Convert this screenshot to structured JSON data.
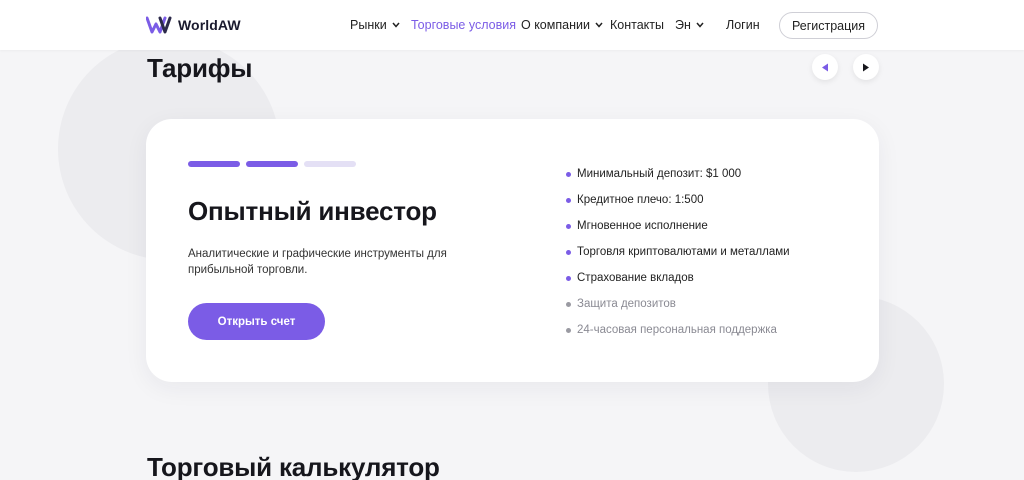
{
  "colors": {
    "accent": "#7b5ce6",
    "accent_light": "#e4e0f5",
    "muted_dot": "#9a9aa2"
  },
  "header": {
    "logo_text": "WorldAW",
    "nav": [
      {
        "label": "Рынки",
        "has_dropdown": true,
        "active": false
      },
      {
        "label": "Торговые условия",
        "has_dropdown": false,
        "active": true
      },
      {
        "label": "О компании",
        "has_dropdown": true,
        "active": false
      },
      {
        "label": "Контакты",
        "has_dropdown": false,
        "active": false
      },
      {
        "label": "Эн",
        "has_dropdown": true,
        "active": false
      }
    ],
    "login_label": "Логин",
    "register_label": "Регистрация"
  },
  "tariffs": {
    "title": "Тарифы",
    "prev_icon": "triangle-left-icon",
    "next_icon": "triangle-right-icon",
    "slide_index": 2,
    "slide_count": 3,
    "card": {
      "title": "Опытный инвестор",
      "description": "Аналитические и графические инструменты для прибыльной торговли.",
      "cta_label": "Открыть счет",
      "features": [
        {
          "text": "Минимальный депозит: $1 000",
          "included": true
        },
        {
          "text": "Кредитное плечо: 1:500",
          "included": true
        },
        {
          "text": "Мгновенное исполнение",
          "included": true
        },
        {
          "text": "Торговля криптовалютами и металлами",
          "included": true
        },
        {
          "text": "Страхование вкладов",
          "included": true
        },
        {
          "text": "Защита депозитов",
          "included": false
        },
        {
          "text": "24-часовая персональная поддержка",
          "included": false
        }
      ]
    }
  },
  "calculator": {
    "title": "Торговый калькулятор"
  }
}
